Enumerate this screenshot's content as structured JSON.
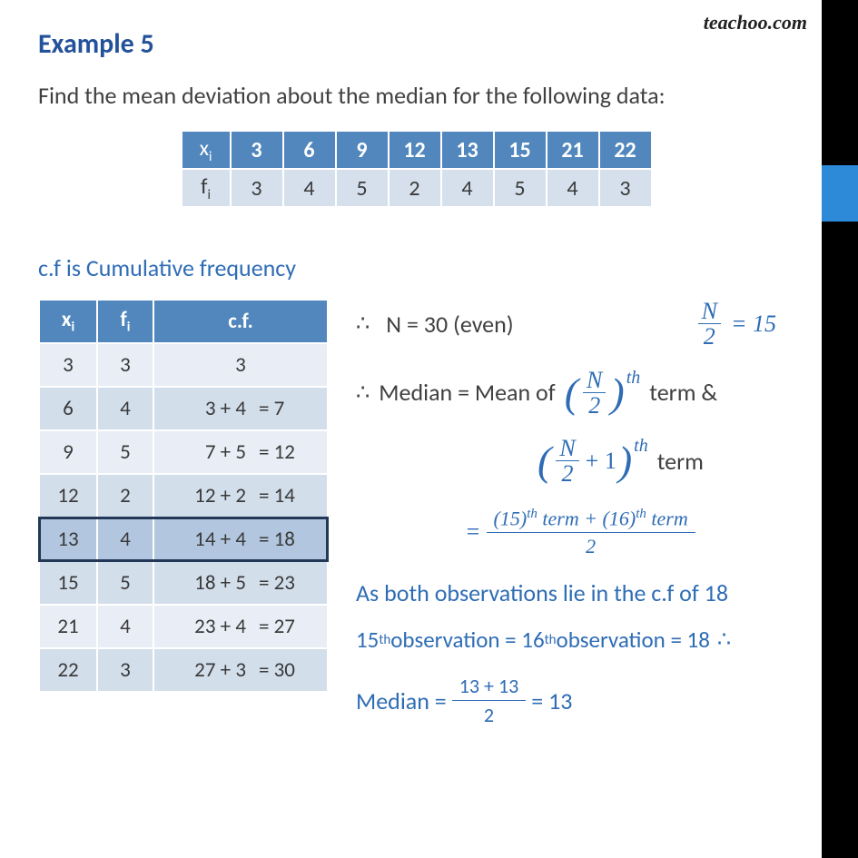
{
  "watermark": "teachoo.com",
  "header": {
    "label": "Example 5"
  },
  "prompt": "Find the mean deviation about the median for the following data:",
  "freq": {
    "xi_label": "x",
    "fi_label": "f",
    "sub": "i",
    "xi": [
      "3",
      "6",
      "9",
      "12",
      "13",
      "15",
      "21",
      "22"
    ],
    "fi": [
      "3",
      "4",
      "5",
      "2",
      "4",
      "5",
      "4",
      "3"
    ]
  },
  "cf_caption": "c.f is Cumulative frequency",
  "cft": {
    "headers": {
      "xi": "x",
      "fi": "f",
      "cf": "c.f.",
      "sub": "i"
    },
    "rows": [
      {
        "x": "3",
        "f": "3",
        "expr": "3",
        "res": ""
      },
      {
        "x": "6",
        "f": "4",
        "expr": "3 + 4",
        "res": "= 7"
      },
      {
        "x": "9",
        "f": "5",
        "expr": "7 + 5",
        "res": "= 12"
      },
      {
        "x": "12",
        "f": "2",
        "expr": "12 + 2",
        "res": "= 14"
      },
      {
        "x": "13",
        "f": "4",
        "expr": "14 + 4",
        "res": "= 18"
      },
      {
        "x": "15",
        "f": "5",
        "expr": "18 + 5",
        "res": "= 23"
      },
      {
        "x": "21",
        "f": "4",
        "expr": "23 + 4",
        "res": "= 27"
      },
      {
        "x": "22",
        "f": "3",
        "expr": "27 + 3",
        "res": "= 30"
      }
    ],
    "highlight_index": 4
  },
  "work": {
    "n_stmt": "N = 30 (even)",
    "nhalf_lhs": "N",
    "nhalf_den": "2",
    "nhalf_eq": "= 15",
    "median_lead": "Median = Mean of",
    "term_word": "term &",
    "term_word2": "term",
    "plus1": "+ 1",
    "th": "th",
    "frac_top": "(15)ᵗʰ term + (16)ᵗʰ term",
    "frac_bot": "2",
    "eqsym": "=",
    "note1": "As both observations lie in the c.f of 18",
    "obs_line_a": "15",
    "obs_line_mid": " observation = 16",
    "obs_line_end": " observation = 18",
    "median_final_lead": "Median =",
    "median_final_top": "13 + 13",
    "median_final_bot": "2",
    "median_final_res": "= 13",
    "therefore": "∴"
  },
  "chart_data": {
    "type": "table",
    "title": "Cumulative frequency and median computation",
    "x": [
      3,
      6,
      9,
      12,
      13,
      15,
      21,
      22
    ],
    "f": [
      3,
      4,
      5,
      2,
      4,
      5,
      4,
      3
    ],
    "cumulative_frequency": [
      3,
      7,
      12,
      14,
      18,
      23,
      27,
      30
    ],
    "N": 30,
    "N_over_2": 15,
    "median_positions": [
      15,
      16
    ],
    "median_cf_bucket": 18,
    "median_value": 13
  }
}
